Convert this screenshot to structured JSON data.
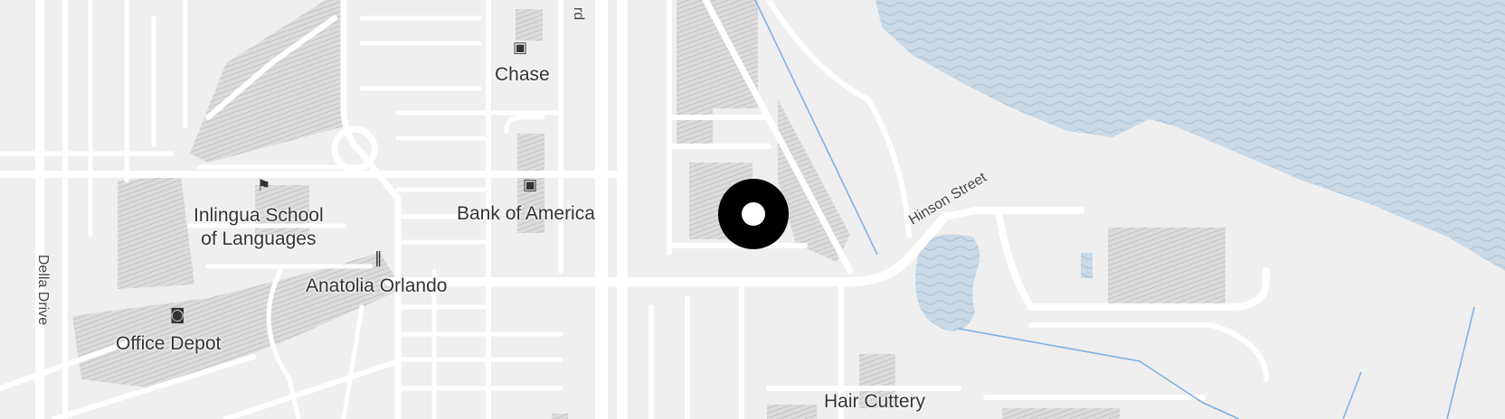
{
  "map": {
    "colors": {
      "land": "#efefef",
      "road": "#ffffff",
      "water": "#c9d9e6",
      "building_hatch": "#bdbdbd",
      "stream": "#7fb0e6",
      "pin": "#000000"
    },
    "places": {
      "chase": "Chase",
      "bank_of_america": "Bank of America",
      "inlingua_line1": "Inlingua School",
      "inlingua_line2": "of Languages",
      "anatolia": "Anatolia Orlando",
      "office_depot": "Office Depot",
      "hair_cuttery": "Hair Cuttery"
    },
    "streets": {
      "della_drive": "Della Drive",
      "hinson_street": "Hinson Street",
      "boulevard_fragment": "rd"
    },
    "icons": {
      "bank": "bank-icon",
      "school": "school-icon",
      "restaurant": "restaurant-icon",
      "shopping": "shopping-bag-icon",
      "location_pin": "location-pin-icon"
    }
  }
}
